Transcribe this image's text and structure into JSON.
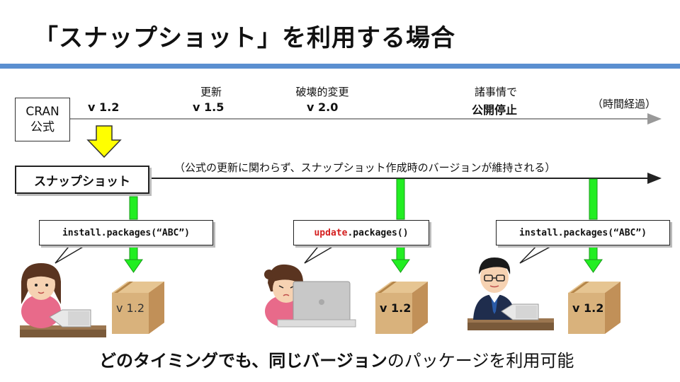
{
  "title": "「スナップショット」を利用する場合",
  "timeline": {
    "source_label_line1": "CRAN",
    "source_label_line2": "公式",
    "elapsed_label": "（時間経過）",
    "versions": [
      {
        "label": "v 1.2"
      },
      {
        "event": "更新",
        "label": "v 1.5"
      },
      {
        "event": "破壊的変更",
        "label": "v 2.0"
      },
      {
        "event": "諸事情で",
        "label": "公開停止"
      }
    ]
  },
  "snapshot": {
    "label": "スナップショット",
    "note": "（公式の更新に関わらず、スナップショット作成時のバージョンが維持される）"
  },
  "users": [
    {
      "command_prefix": "",
      "command_highlight": "",
      "command_rest": "install.packages(“ABC”)",
      "package_version": "v 1.2",
      "version_bold": false,
      "avatar": "woman-at-laptop"
    },
    {
      "command_prefix": "",
      "command_highlight": "update",
      "command_rest": ".packages()",
      "package_version": "v 1.2",
      "version_bold": true,
      "avatar": "girl-at-laptop"
    },
    {
      "command_prefix": "",
      "command_highlight": "",
      "command_rest": "install.packages(“ABC”)",
      "package_version": "v 1.2",
      "version_bold": true,
      "avatar": "man-at-laptop"
    }
  ],
  "conclusion": {
    "part1": "どのタイミングでも、",
    "part2": "同じバージョン",
    "part3": "のパッケージを利用可能"
  },
  "colors": {
    "accent_bar": "#5b8fd0",
    "arrow_green": "#22ee22",
    "arrow_yellow": "#ffff00",
    "highlight_red": "#d42020",
    "box_tan": "#d9b27c"
  }
}
